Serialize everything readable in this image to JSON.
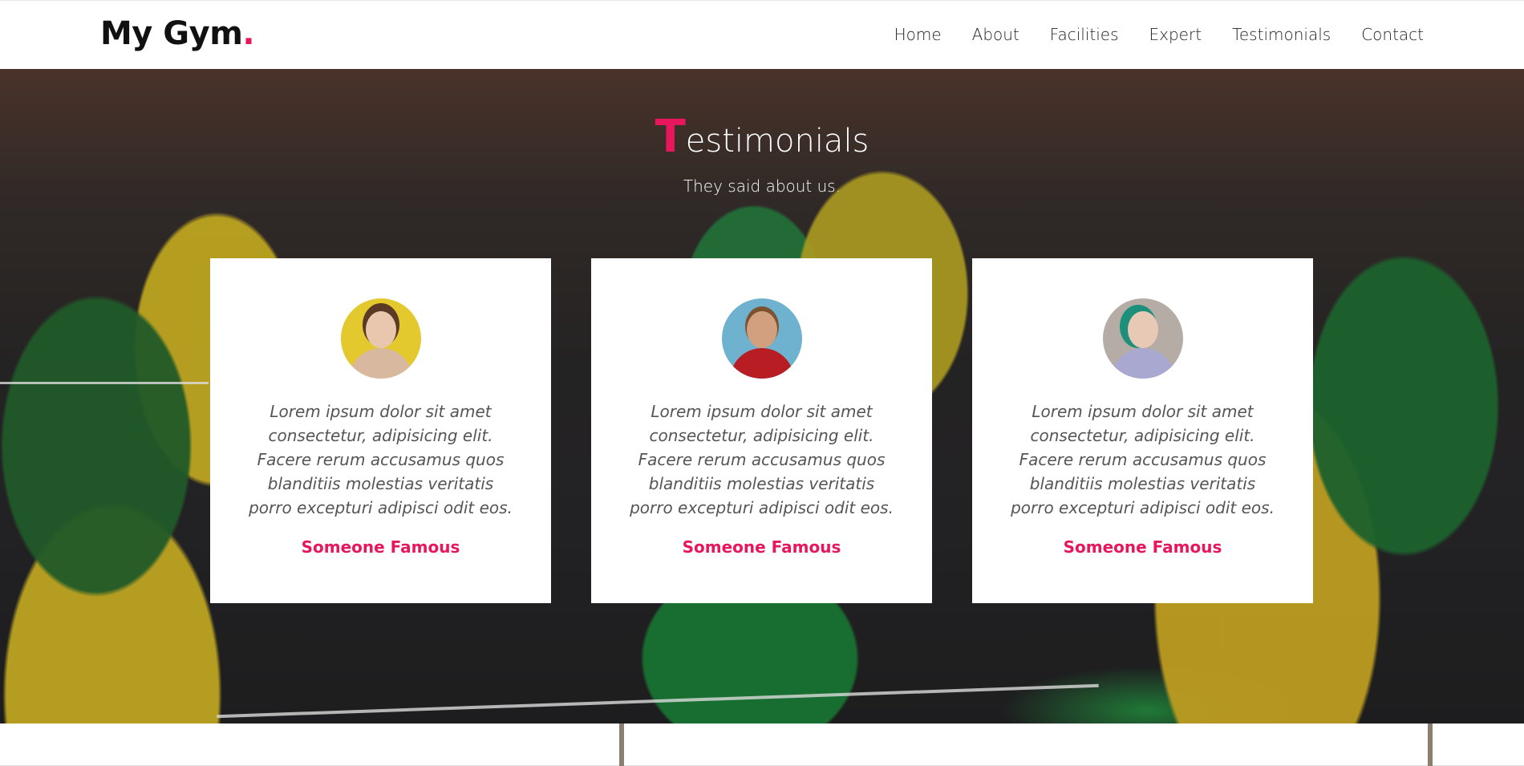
{
  "brand": {
    "name": "My Gym",
    "dot": ".",
    "accent_color": "#e8175d"
  },
  "nav": {
    "items": [
      "Home",
      "About",
      "Facilities",
      "Expert",
      "Testimonials",
      "Contact"
    ]
  },
  "testimonials": {
    "title_first_letter": "T",
    "title_rest": "estimonials",
    "subtitle": "They said about us.",
    "cards": [
      {
        "quote": "Lorem ipsum dolor sit amet consectetur, adipisicing elit. Facere rerum accusamus quos blanditiis molestias veritatis porro excepturi adipisci odit eos.",
        "name": "Someone Famous",
        "avatar": "woman-yellow-background-photo"
      },
      {
        "quote": "Lorem ipsum dolor sit amet consectetur, adipisicing elit. Facere rerum accusamus quos blanditiis molestias veritatis porro excepturi adipisci odit eos.",
        "name": "Someone Famous",
        "avatar": "man-red-shirt-photo"
      },
      {
        "quote": "Lorem ipsum dolor sit amet consectetur, adipisicing elit. Facere rerum accusamus quos blanditiis molestias veritatis porro excepturi adipisci odit eos.",
        "name": "Someone Famous",
        "avatar": "woman-green-hair-photo"
      }
    ]
  }
}
